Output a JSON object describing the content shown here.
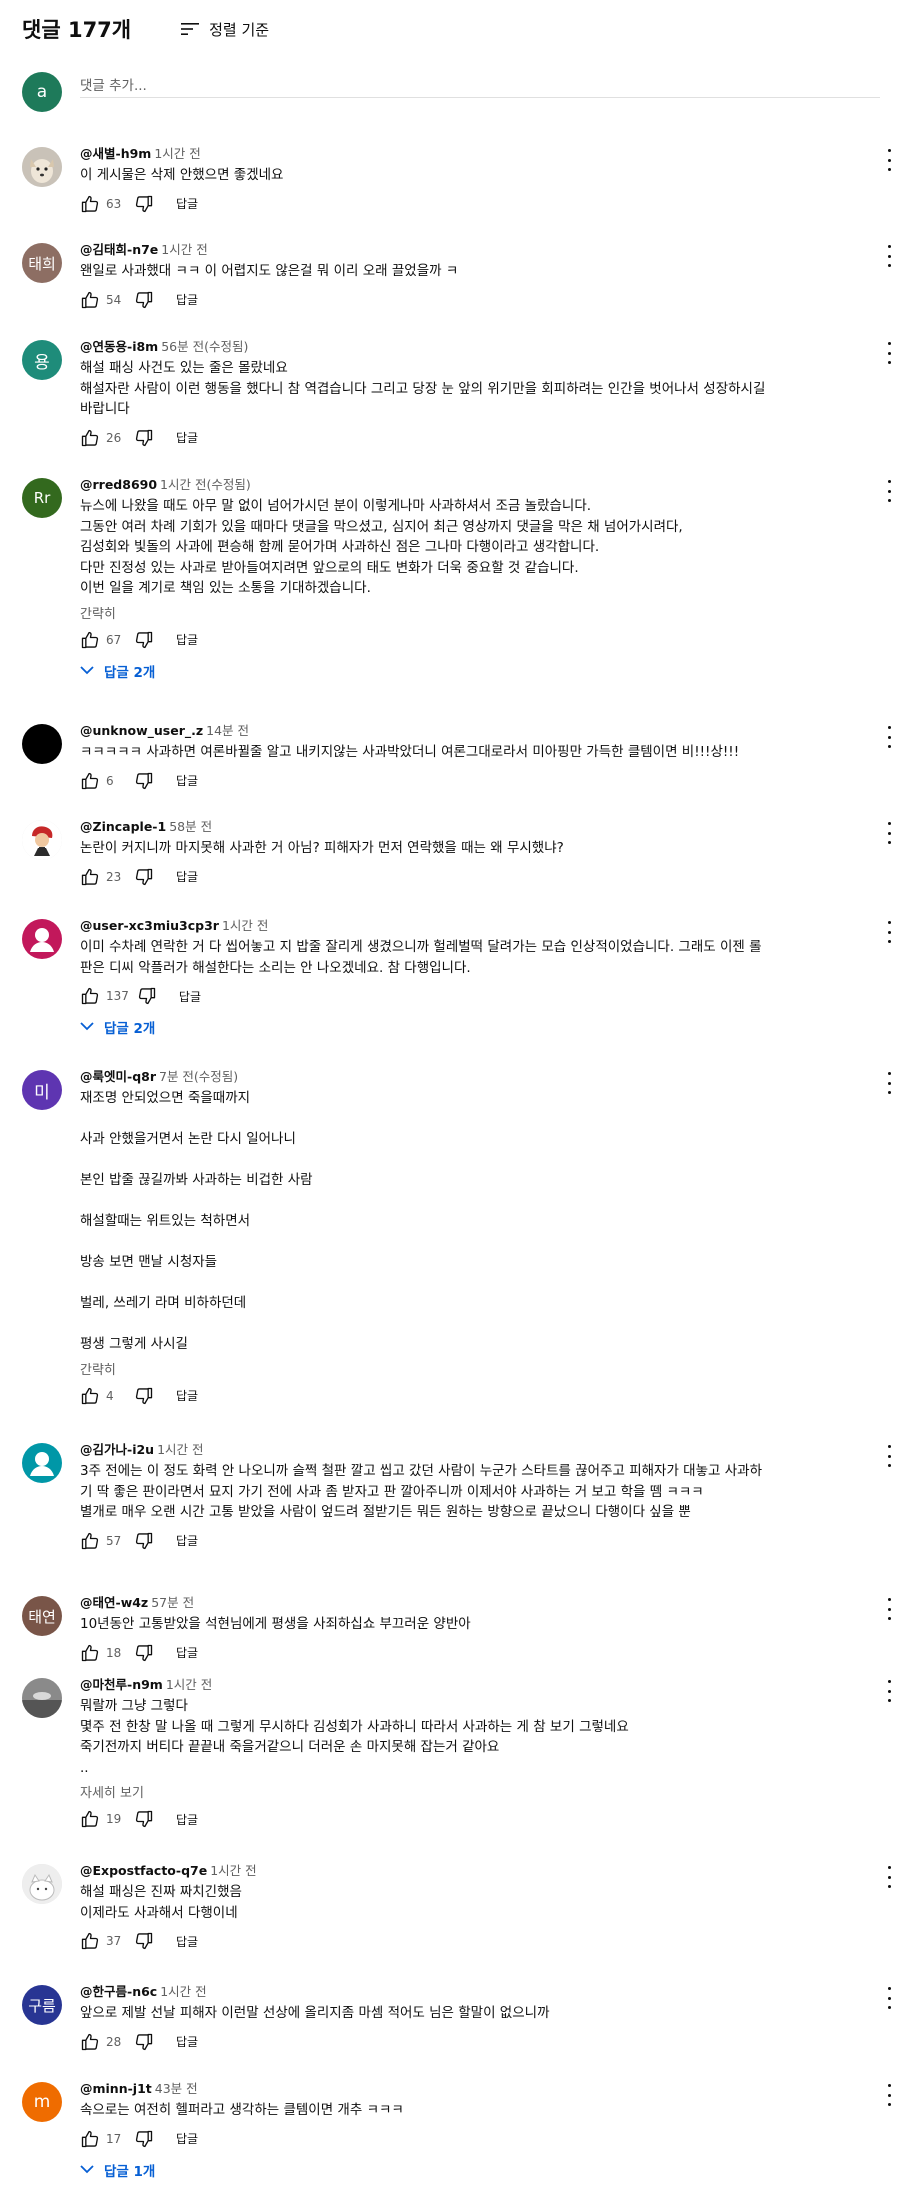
{
  "header": {
    "title": "댓글 177개",
    "sort_label": "정렬 기준"
  },
  "add_comment": {
    "avatar_letter": "a",
    "avatar_color": "#1e7a5a",
    "placeholder": "댓글 추가..."
  },
  "show_less": "간략히",
  "read_more": "자세히 보기",
  "reply_label": "답글",
  "comments": [
    {
      "handle": "@새별-h9m",
      "time": "1시간 전",
      "text": "이 게시물은 삭제 안했으면 좋겠네요",
      "likes": "63",
      "avatar_type": "image",
      "avatar_icon": "dog-photo-avatar"
    },
    {
      "handle": "@김태희-n7e",
      "time": "1시간 전",
      "text": "왠일로 사과했대 ㅋㅋ 이 어렵지도 않은걸 뭐 이리 오래 끌었을까 ㅋ",
      "likes": "54",
      "avatar_type": "text",
      "avatar_text": "태희",
      "avatar_color": "#8d6e63"
    },
    {
      "handle": "@연동용-i8m",
      "time": "56분 전(수정됨)",
      "text": "해설 패싱 사건도 있는 줄은 몰랐네요\n해설자란 사람이 이런 행동을 했다니 참 역겹습니다 그리고 당장 눈 앞의 위기만을 회피하려는 인간을 벗어나서 성장하시길\n바랍니다",
      "likes": "26",
      "avatar_type": "text",
      "avatar_text": "용",
      "avatar_color": "#1e8c7a"
    },
    {
      "handle": "@rred8690",
      "time": "1시간 전(수정됨)",
      "text": "뉴스에 나왔을 때도 아무 말 없이 넘어가시던 분이 이렇게나마 사과하셔서 조금 놀랐습니다.\n그동안 여러 차례 기회가 있을 때마다 댓글을 막으셨고, 심지어 최근 영상까지 댓글을 막은 채 넘어가시려다,\n김성회와 빛돌의 사과에 편승해 함께 묻어가며 사과하신 점은 그나마 다행이라고 생각합니다.\n다만 진정성 있는 사과로 받아들여지려면 앞으로의 태도 변화가 더욱 중요할 것 같습니다.\n이번 일을 계기로 책임 있는 소통을 기대하겠습니다.",
      "likes": "67",
      "avatar_type": "text",
      "avatar_text": "Rr",
      "avatar_color": "#33691e",
      "show_less": true,
      "replies_label": "답글 2개"
    },
    {
      "handle": "@unknow_user_.z",
      "time": "14분 전",
      "text": "ㅋㅋㅋㅋㅋ 사과하면 여론바뀔줄 알고 내키지않는 사과박았더니 여론그대로라서 미아핑만 가득한 클템이면 비!!!상!!!",
      "likes": "6",
      "avatar_type": "text",
      "avatar_text": "",
      "avatar_color": "#000000"
    },
    {
      "handle": "@Zincaple-1",
      "time": "58분 전",
      "text": "논란이 커지니까 마지못해 사과한 거 아님? 피해자가 먼저 연락했을 때는 왜 무시했냐?",
      "likes": "23",
      "avatar_type": "image",
      "avatar_icon": "character-avatar"
    },
    {
      "handle": "@user-xc3miu3cp3r",
      "time": "1시간 전",
      "text": "이미 수차례 연락한 거 다 씹어놓고 지 밥줄 잘리게 생겼으니까 헐레벌떡 달려가는 모습 인상적이었습니다. 그래도 이젠 롤\n판은 디씨 악플러가 해설한다는 소리는 안 나오겠네요. 참 다행입니다.",
      "likes": "137",
      "avatar_type": "person",
      "avatar_icon": "default-person-avatar",
      "avatar_color": "#c2185b",
      "replies_label": "답글 2개"
    },
    {
      "handle": "@룩엣미-q8r",
      "time": "7분 전(수정됨)",
      "text": "재조명 안되었으면 죽을때까지\n\n사과 안했을거면서 논란 다시 일어나니\n\n본인 밥줄 끊길까봐 사과하는 비겁한 사람\n\n해설할때는 위트있는 척하면서\n\n방송 보면 맨날 시청자들\n\n벌레, 쓰레기 라며 비하하던데\n\n평생 그렇게 사시길",
      "likes": "4",
      "avatar_type": "text",
      "avatar_text": "미",
      "avatar_color": "#5e35b1",
      "show_less": true
    },
    {
      "handle": "@김가나-i2u",
      "time": "1시간 전",
      "text": "3주 전에는 이 정도 화력 안 나오니까 슬쩍 철판 깔고 씹고 갔던 사람이 누군가 스타트를 끊어주고 피해자가 대놓고 사과하\n기 딱 좋은 판이라면서 묘지 가기 전에 사과 좀 받자고 판 깔아주니까 이제서야 사과하는 거 보고 학을 뗌 ㅋㅋㅋ\n별개로 매우 오랜 시간 고통 받았을 사람이 엎드려 절받기든 뭐든 원하는 방향으로 끝났으니 다행이다 싶을 뿐",
      "likes": "57",
      "avatar_type": "person",
      "avatar_icon": "default-person-avatar",
      "avatar_color": "#0097a7"
    },
    {
      "handle": "@태연-w4z",
      "time": "57분 전",
      "text": "10년동안 고통받았을 석현님에게 평생을 사죄하십쇼 부끄러운 양반아",
      "likes": "18",
      "avatar_type": "text",
      "avatar_text": "태연",
      "avatar_color": "#795548"
    },
    {
      "handle": "@마천루-n9m",
      "time": "1시간 전",
      "text": "뭐랄까 그냥 그렇다\n몇주 전 한창 말 나올 때 그렇게 무시하다 김성회가 사과하니 따라서 사과하는 게 참 보기 그렇네요\n죽기전까지 버티다 끝끝내 죽을거같으니 더러운 손 마지못해 잡는거 같아요\n..",
      "likes": "19",
      "avatar_type": "image",
      "avatar_icon": "gray-photo-avatar",
      "read_more": true
    },
    {
      "handle": "@Expostfacto-q7e",
      "time": "1시간 전",
      "text": "해설 패싱은 진짜 짜치긴했음\n이제라도 사과해서 다행이네",
      "likes": "37",
      "avatar_type": "image",
      "avatar_icon": "cat-photo-avatar"
    },
    {
      "handle": "@한구름-n6c",
      "time": "1시간 전",
      "text": "앞으로 제발 선날 피해자 이런말 선상에 올리지좀 마셈 적어도 님은 할말이 없으니까",
      "likes": "28",
      "avatar_type": "text",
      "avatar_text": "구름",
      "avatar_color": "#283593"
    },
    {
      "handle": "@minn-j1t",
      "time": "43분 전",
      "text": "속으로는 여전히 헬퍼라고 생각하는 클템이면 개추 ㅋㅋㅋ",
      "likes": "17",
      "avatar_type": "text",
      "avatar_text": "m",
      "avatar_color": "#ef6c00",
      "replies_label": "답글 1개"
    }
  ]
}
